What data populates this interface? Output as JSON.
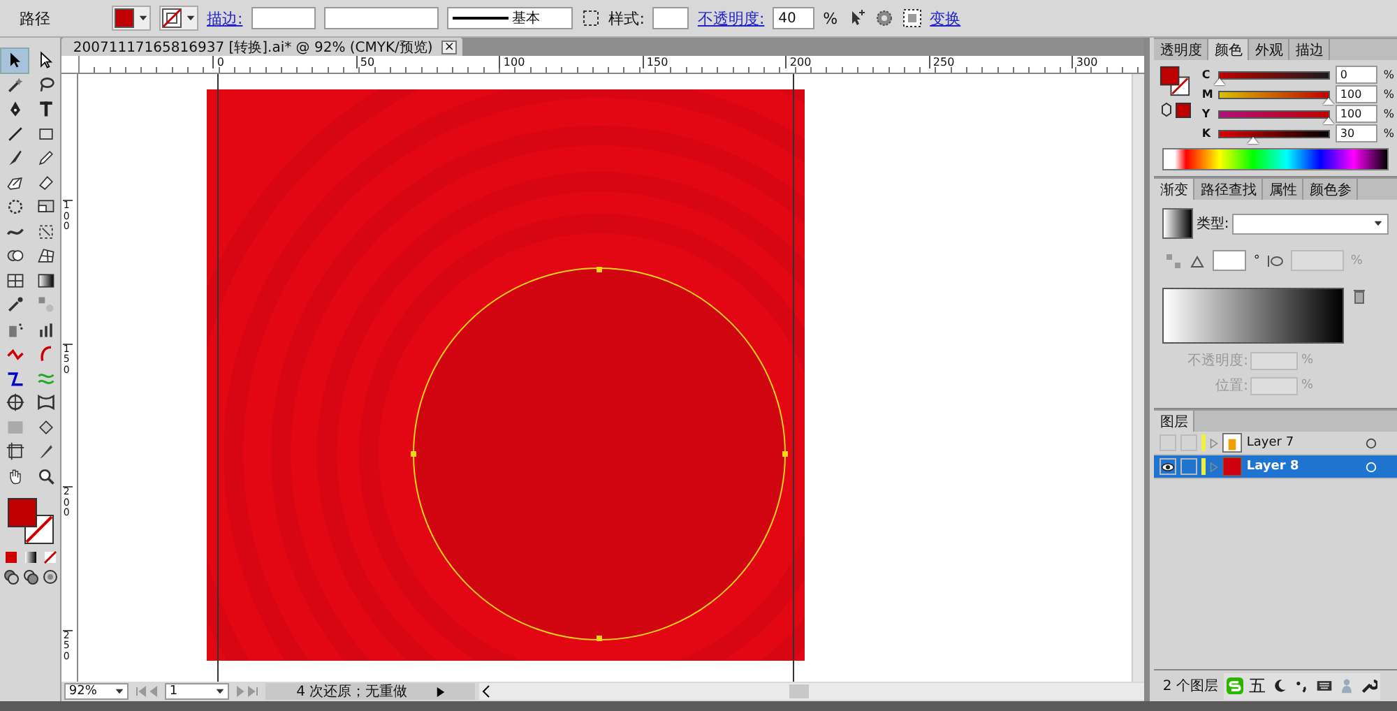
{
  "control_bar": {
    "object_label": "路径",
    "stroke_link": "描边:",
    "stroke_profile": "基本",
    "style_label": "样式:",
    "opacity_link": "不透明度:",
    "opacity_value": "40",
    "opacity_unit": "%",
    "transform_link": "变换"
  },
  "document_tab": {
    "title": "20071117165816937 [转换].ai* @ 92% (CMYK/预览)",
    "close": "×"
  },
  "rulers": {
    "horizontal": [
      "0",
      "50",
      "100",
      "150",
      "200",
      "250",
      "300"
    ],
    "vertical": [
      "100",
      "150",
      "200",
      "250"
    ]
  },
  "toolbox": {
    "tools": [
      {
        "selected": true
      },
      {
        "selected": false
      },
      {
        "selected": false
      },
      {
        "selected": false
      },
      {
        "selected": false
      },
      {
        "selected": false
      },
      {
        "selected": false
      },
      {
        "selected": false
      },
      {
        "selected": false
      },
      {
        "selected": false
      },
      {
        "selected": false
      },
      {
        "selected": false
      },
      {
        "selected": false
      },
      {
        "selected": false
      },
      {
        "selected": false
      },
      {
        "selected": false
      },
      {
        "selected": false
      },
      {
        "selected": false
      },
      {
        "selected": false
      },
      {
        "selected": false
      },
      {
        "selected": false
      },
      {
        "selected": false
      },
      {
        "selected": false
      },
      {
        "selected": false
      },
      {
        "selected": false
      },
      {
        "selected": false
      },
      {
        "selected": false
      },
      {
        "selected": false
      },
      {
        "selected": false
      },
      {
        "selected": false
      },
      {
        "selected": false
      },
      {
        "selected": false
      },
      {
        "selected": false
      },
      {
        "selected": false
      },
      {
        "selected": false
      },
      {
        "selected": false
      }
    ]
  },
  "color_panel": {
    "tabs": [
      {
        "label": "透明度",
        "selected": false
      },
      {
        "label": "颜色",
        "selected": true
      },
      {
        "label": "外观",
        "selected": false
      },
      {
        "label": "描边",
        "selected": false
      }
    ],
    "channels": [
      {
        "name": "C",
        "value": "0",
        "unit": "%",
        "level": 0
      },
      {
        "name": "M",
        "value": "100",
        "unit": "%",
        "level": 1
      },
      {
        "name": "Y",
        "value": "100",
        "unit": "%",
        "level": 1
      },
      {
        "name": "K",
        "value": "30",
        "unit": "%",
        "level": 0.3
      }
    ]
  },
  "gradient_panel": {
    "tabs": [
      {
        "label": "渐变",
        "selected": true
      },
      {
        "label": "路径查找",
        "selected": false
      },
      {
        "label": "属性",
        "selected": false
      },
      {
        "label": "颜色参",
        "selected": false
      }
    ],
    "type_label": "类型:",
    "angle_unit": "°",
    "ratio_unit": "%",
    "opacity_label": "不透明度:",
    "opacity_unit": "%",
    "location_label": "位置:",
    "location_unit": "%"
  },
  "layers_panel": {
    "tab": "图层",
    "layers": [
      {
        "name": "Layer 7",
        "visible": false,
        "selected": false
      },
      {
        "name": "Layer 8",
        "visible": true,
        "selected": true
      }
    ],
    "footer": "2 个图层"
  },
  "status_bar": {
    "zoom": "92%",
    "page": "1",
    "status": "4 次还原；无重做"
  },
  "ime_bar": {
    "mode": "五"
  }
}
